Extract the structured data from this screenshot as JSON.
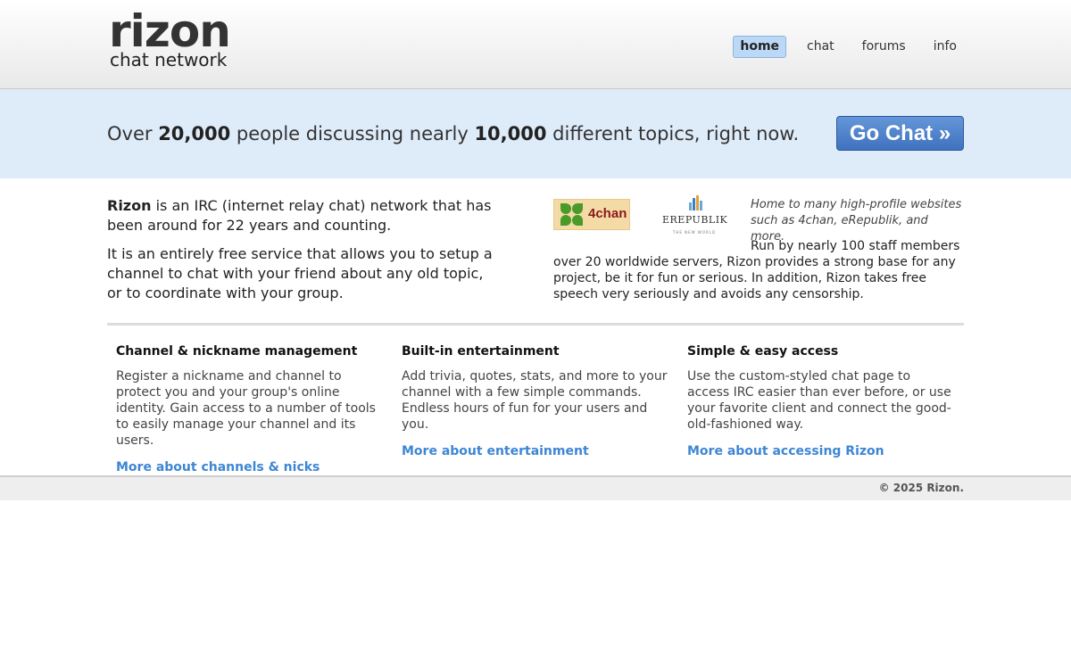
{
  "logo": {
    "main": "rizon",
    "sub": "chat network"
  },
  "nav": [
    {
      "label": "home",
      "active": true
    },
    {
      "label": "chat",
      "active": false
    },
    {
      "label": "forums",
      "active": false
    },
    {
      "label": "info",
      "active": false
    }
  ],
  "banner": {
    "prefix": "Over ",
    "people": "20,000",
    "middle": " people discussing nearly ",
    "topics": "10,000",
    "suffix": " different topics, right now.",
    "button": "Go Chat »"
  },
  "intro": {
    "brand": "Rizon",
    "p1_rest": " is an IRC (internet relay chat) network that has been around for 22 years and counting.",
    "p2": "It is an entirely free service that allows you to setup a channel to chat with your friend about any old topic, or to coordinate with your group.",
    "logo_4chan": "4chan",
    "logo_erep": "EREPUBLIK",
    "logo_erep_sub": "THE NEW WORLD",
    "home_to": "Home to many high-profile websites such as 4chan, eRepublik, and more.",
    "run_by_first": "Run by nearly 100 staff members",
    "run_by_rest": "over 20 worldwide servers, Rizon provides a strong base for any project, be it for fun or serious. In addition, Rizon takes free speech very seriously and avoids any censorship."
  },
  "features": [
    {
      "title": "Channel & nickname management",
      "text": "Register a nickname and channel to protect you and your group's online identity. Gain access to a number of tools to easily manage your channel and its users.",
      "link": "More about channels & nicks"
    },
    {
      "title": "Built-in entertainment",
      "text": "Add trivia, quotes, stats, and more to your channel with a few simple commands. Endless hours of fun for your users and you.",
      "link": "More about entertainment"
    },
    {
      "title": "Simple & easy access",
      "text": "Use the custom-styled chat page to access IRC easier than ever before, or use your favorite client and connect the good-old-fashioned way.",
      "link": "More about accessing Rizon"
    }
  ],
  "footer": {
    "copyright": "© 2025 Rizon."
  }
}
